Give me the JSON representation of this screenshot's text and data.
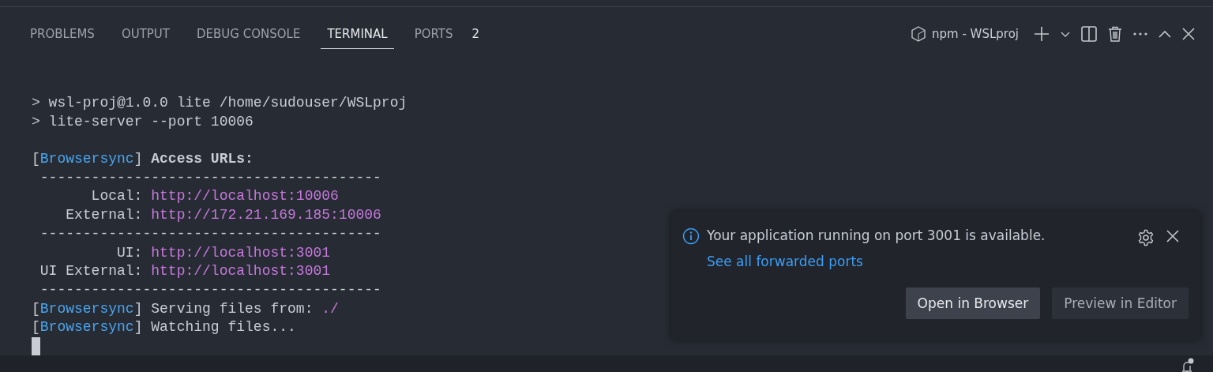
{
  "panel": {
    "tabs": [
      {
        "label": "PROBLEMS",
        "selected": false
      },
      {
        "label": "OUTPUT",
        "selected": false
      },
      {
        "label": "DEBUG CONSOLE",
        "selected": false
      },
      {
        "label": "TERMINAL",
        "selected": true
      },
      {
        "label": "PORTS",
        "selected": false,
        "badge": "2"
      }
    ],
    "terminal_name": "npm - WSLproj"
  },
  "terminal": {
    "lines": [
      {
        "kind": "text",
        "segments": [
          {
            "kind": "plain",
            "text": "> wsl-proj@1.0.0 lite /home/sudouser/WSLproj"
          }
        ]
      },
      {
        "kind": "text",
        "segments": [
          {
            "kind": "plain",
            "text": "> lite-server --port 10006"
          }
        ]
      },
      {
        "kind": "blank"
      },
      {
        "kind": "text",
        "segments": [
          {
            "kind": "plain",
            "text": "["
          },
          {
            "kind": "accent",
            "text": "Browsersync"
          },
          {
            "kind": "plain",
            "text": "] "
          },
          {
            "kind": "bold",
            "text": "Access URLs:"
          }
        ]
      },
      {
        "kind": "text",
        "segments": [
          {
            "kind": "plain",
            "text": " ----------------------------------------"
          }
        ]
      },
      {
        "kind": "text",
        "segments": [
          {
            "kind": "plain",
            "text": "       Local: "
          },
          {
            "kind": "url",
            "text": "http://localhost:10006"
          }
        ]
      },
      {
        "kind": "text",
        "segments": [
          {
            "kind": "plain",
            "text": "    External: "
          },
          {
            "kind": "url",
            "text": "http://172.21.169.185:10006"
          }
        ]
      },
      {
        "kind": "text",
        "segments": [
          {
            "kind": "plain",
            "text": " ----------------------------------------"
          }
        ]
      },
      {
        "kind": "text",
        "segments": [
          {
            "kind": "plain",
            "text": "          UI: "
          },
          {
            "kind": "url",
            "text": "http://localhost:3001"
          }
        ]
      },
      {
        "kind": "text",
        "segments": [
          {
            "kind": "plain",
            "text": " UI External: "
          },
          {
            "kind": "url",
            "text": "http://localhost:3001"
          }
        ]
      },
      {
        "kind": "text",
        "segments": [
          {
            "kind": "plain",
            "text": " ----------------------------------------"
          }
        ]
      },
      {
        "kind": "text",
        "segments": [
          {
            "kind": "plain",
            "text": "["
          },
          {
            "kind": "accent",
            "text": "Browsersync"
          },
          {
            "kind": "plain",
            "text": "] Serving files from: "
          },
          {
            "kind": "url",
            "text": "./"
          }
        ]
      },
      {
        "kind": "text",
        "segments": [
          {
            "kind": "plain",
            "text": "["
          },
          {
            "kind": "accent",
            "text": "Browsersync"
          },
          {
            "kind": "plain",
            "text": "] Watching files..."
          }
        ]
      }
    ],
    "cursor_visible": true
  },
  "notification": {
    "message": "Your application running on port 3001 is available.",
    "link": "See all forwarded ports",
    "buttons": [
      {
        "label": "Open in Browser",
        "primary": true
      },
      {
        "label": "Preview in Editor",
        "primary": false
      }
    ]
  },
  "status_bar": {
    "notification_dot": true
  }
}
